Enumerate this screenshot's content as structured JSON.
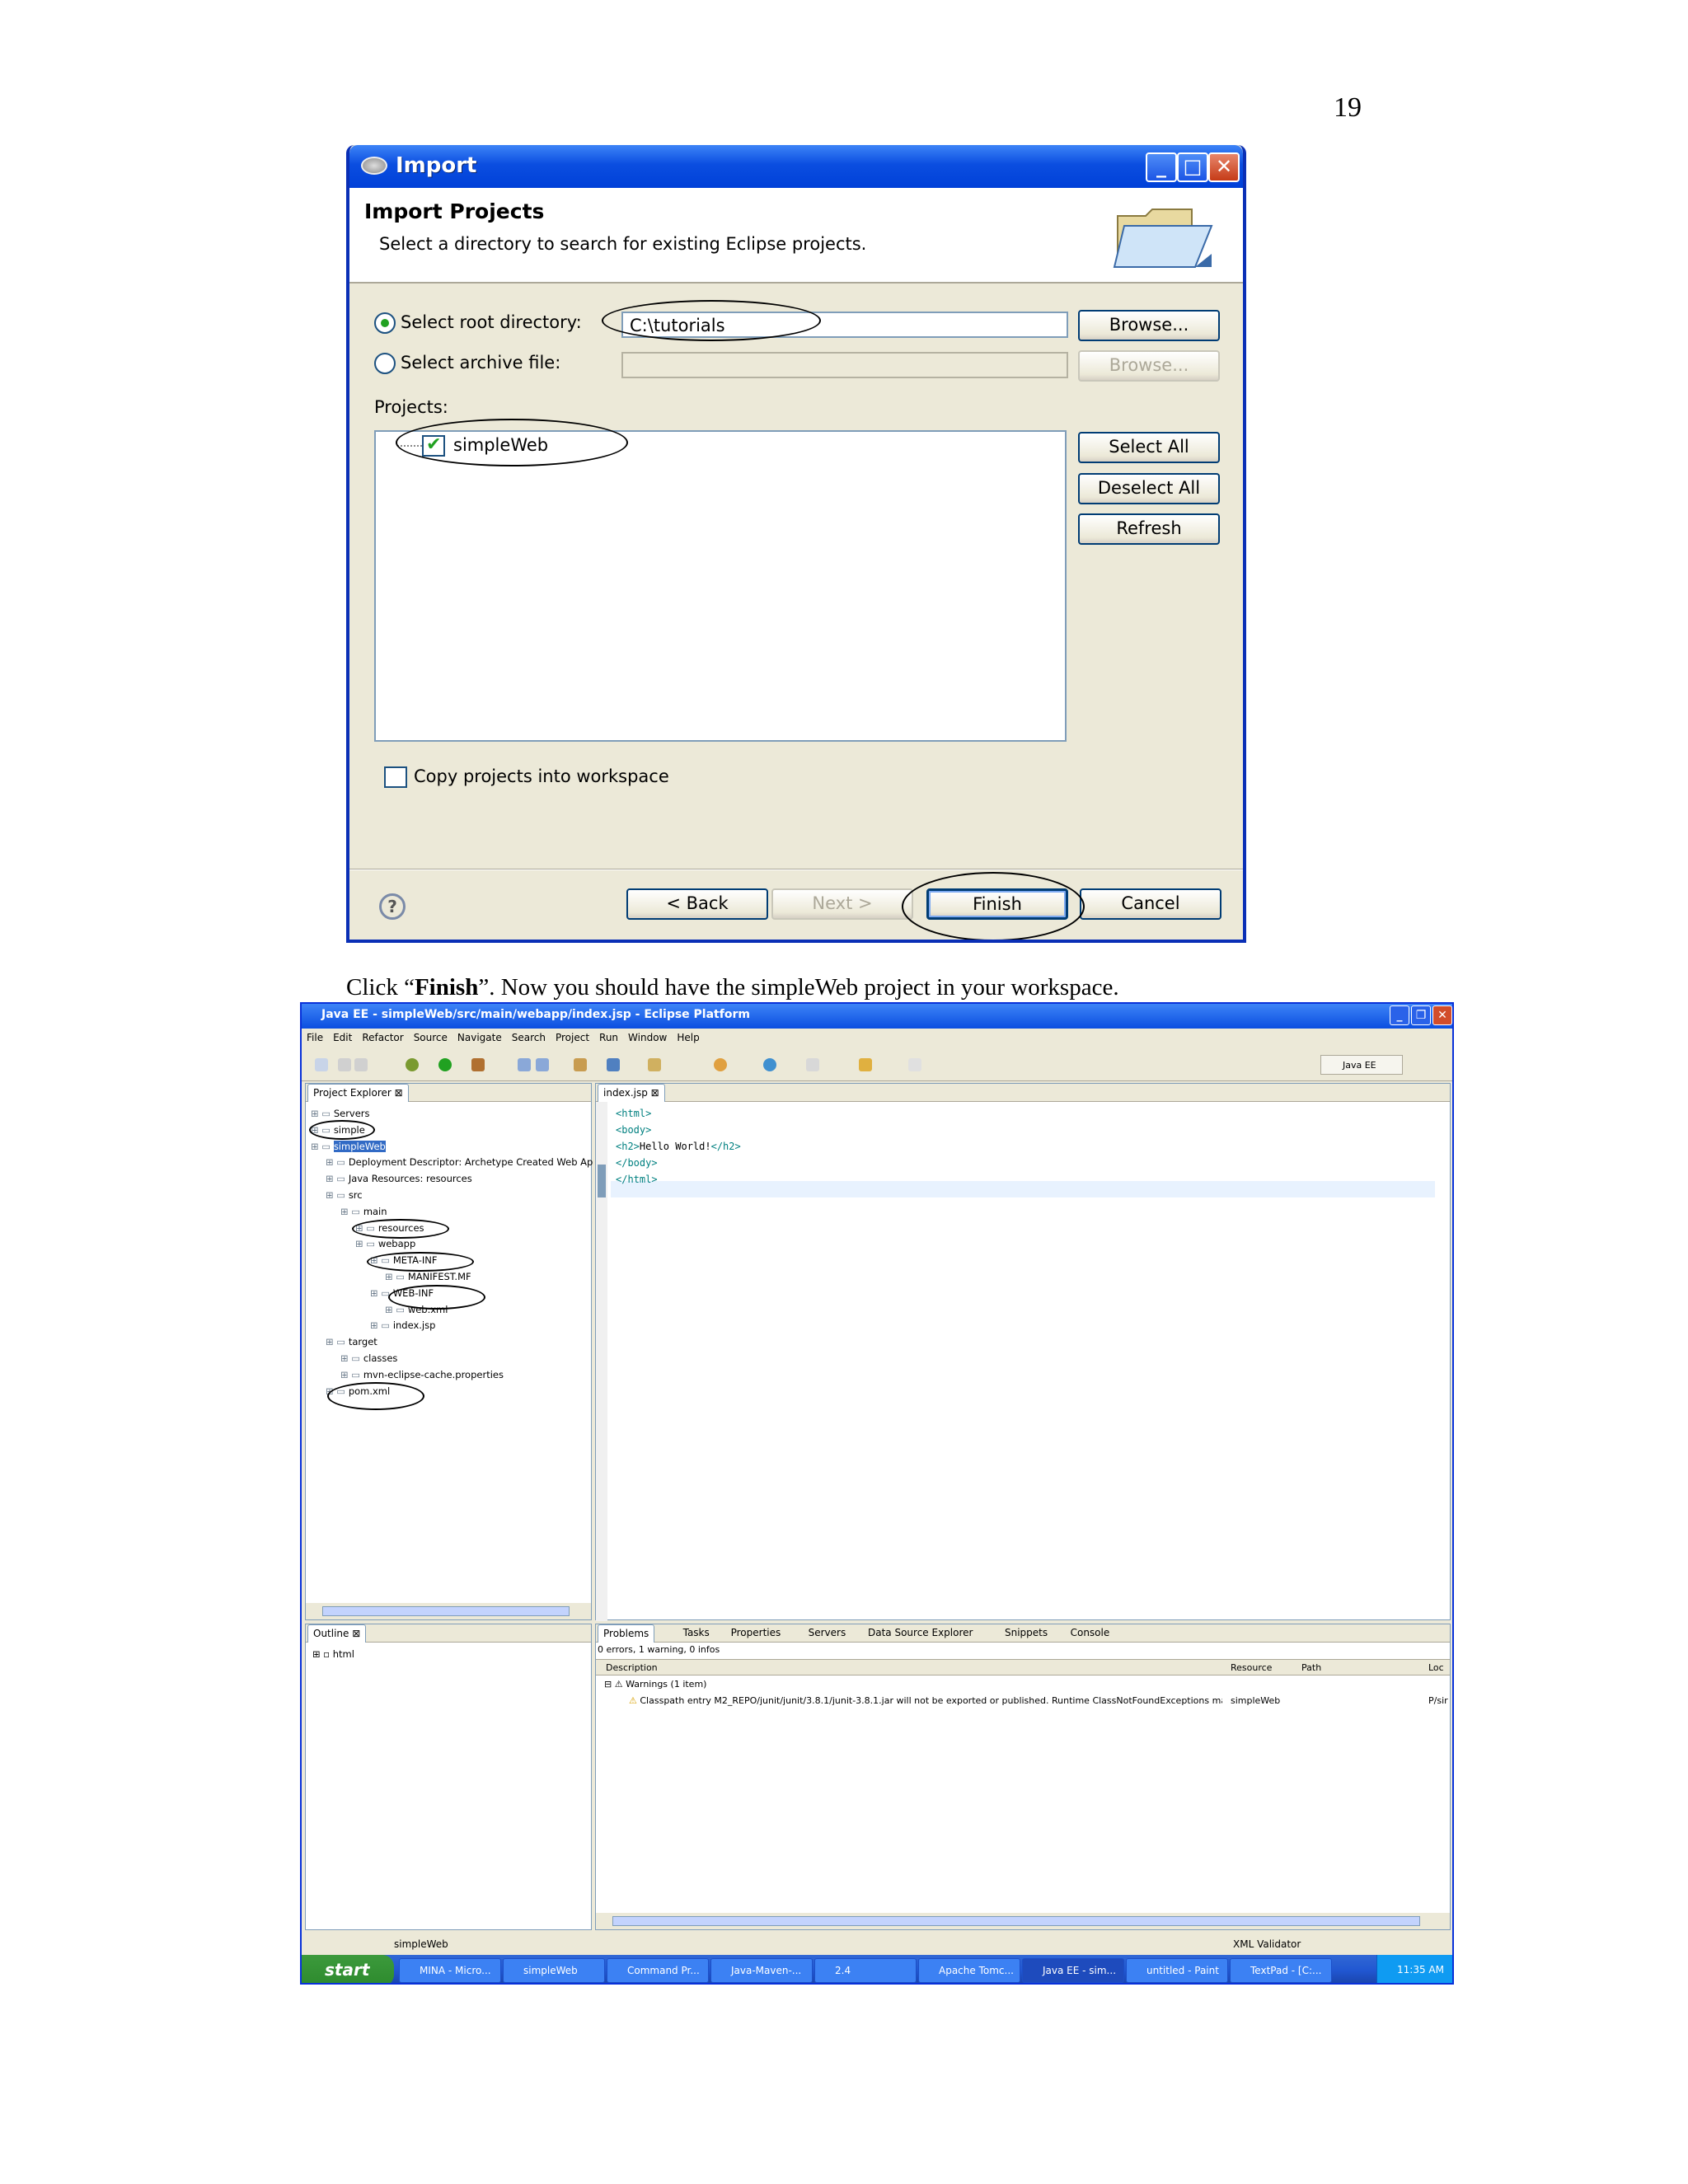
{
  "page_number": "19",
  "import_dialog": {
    "title": "Import",
    "header_title": "Import Projects",
    "header_desc": "Select a directory to search for existing Eclipse projects.",
    "root_dir_label": "Select root directory:",
    "root_dir_value": "C:\\tutorials",
    "archive_label": "Select archive file:",
    "browse_label": "Browse...",
    "browse2_label": "Browse...",
    "projects_label": "Projects:",
    "project_item": "simpleWeb",
    "select_all": "Select All",
    "deselect_all": "Deselect All",
    "refresh": "Refresh",
    "copy_label": "Copy projects into workspace",
    "back": "< Back",
    "next": "Next >",
    "finish": "Finish",
    "cancel": "Cancel",
    "help_glyph": "?"
  },
  "caption": {
    "pre": "Click “",
    "bold": "Finish",
    "post": "”. Now you should have the simpleWeb project in your workspace."
  },
  "eclipse": {
    "title": "Java EE - simpleWeb/src/main/webapp/index.jsp - Eclipse Platform",
    "menu": [
      "File",
      "Edit",
      "Refactor",
      "Source",
      "Navigate",
      "Search",
      "Project",
      "Run",
      "Window",
      "Help"
    ],
    "perspective": "Java EE",
    "project_explorer_tab": "Project Explorer",
    "editor_tab": "index.jsp",
    "tree": [
      {
        "label": "Servers",
        "indent": 0
      },
      {
        "label": "simple",
        "indent": 0
      },
      {
        "label": "simpleWeb",
        "indent": 0
      },
      {
        "label": "Deployment Descriptor: Archetype Created Web Ap",
        "indent": 1
      },
      {
        "label": "Java Resources: resources",
        "indent": 1
      },
      {
        "label": "src",
        "indent": 1
      },
      {
        "label": "main",
        "indent": 2
      },
      {
        "label": "resources",
        "indent": 3
      },
      {
        "label": "webapp",
        "indent": 3
      },
      {
        "label": "META-INF",
        "indent": 4
      },
      {
        "label": "MANIFEST.MF",
        "indent": 5
      },
      {
        "label": "WEB-INF",
        "indent": 4
      },
      {
        "label": "web.xml",
        "indent": 5
      },
      {
        "label": "index.jsp",
        "indent": 4
      },
      {
        "label": "target",
        "indent": 1
      },
      {
        "label": "classes",
        "indent": 2
      },
      {
        "label": "mvn-eclipse-cache.properties",
        "indent": 2
      },
      {
        "label": "pom.xml",
        "indent": 1
      }
    ],
    "code_lines": [
      {
        "tag_open": "<html>",
        "text": "",
        "tag_close": ""
      },
      {
        "tag_open": "<body>",
        "text": "",
        "tag_close": ""
      },
      {
        "tag_open": "<h2>",
        "text": "Hello World!",
        "tag_close": "</h2>"
      },
      {
        "tag_open": "</body>",
        "text": "",
        "tag_close": ""
      },
      {
        "tag_open": "</html>",
        "text": "",
        "tag_close": ""
      }
    ],
    "outline_tab": "Outline",
    "outline_item": "html",
    "bottom_tabs": [
      "Problems",
      "Tasks",
      "Properties",
      "Servers",
      "Data Source Explorer",
      "Snippets",
      "Console"
    ],
    "problems_summary": "0 errors, 1 warning, 0 infos",
    "col_description": "Description",
    "col_resource": "Resource",
    "col_path": "Path",
    "col_loc": "Loc",
    "warnings_group": "Warnings (1 item)",
    "warning_text": "Classpath entry M2_REPO/junit/junit/3.8.1/junit-3.8.1.jar will not be exported or published. Runtime ClassNotFoundExceptions may",
    "warning_resource": "simpleWeb",
    "warning_loc": "P/sir",
    "status_left": "simpleWeb",
    "status_right": "XML Validator",
    "taskbar": {
      "start": "start",
      "items": [
        "MINA - Micro...",
        "simpleWeb",
        "Command Pr...",
        "Java-Maven-...",
        "2.4",
        "Apache Tomc...",
        "Java EE - sim...",
        "untitled - Paint",
        "TextPad - [C:..."
      ],
      "clock": "11:35 AM"
    }
  },
  "colors": {
    "xp_blue": "#0b4ee0",
    "dialog_bg": "#ece9d8",
    "tag_teal": "#008080"
  }
}
